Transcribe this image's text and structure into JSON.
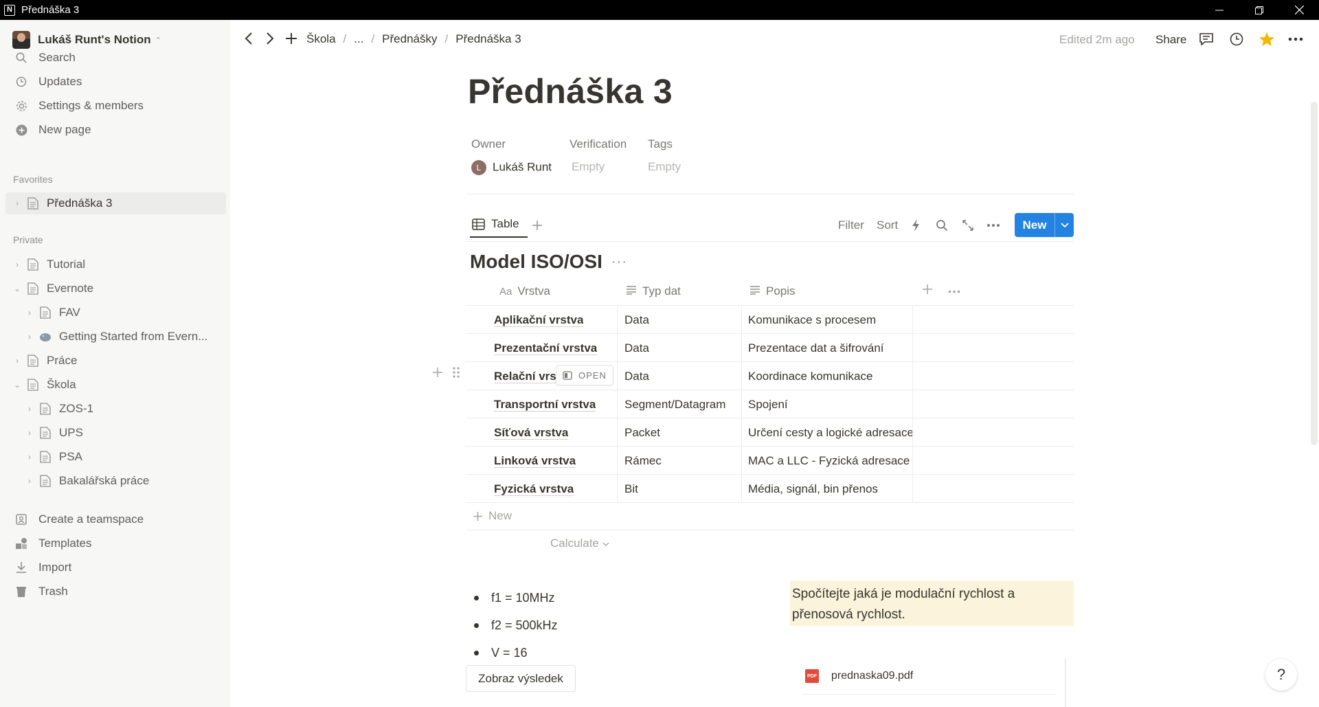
{
  "window": {
    "title": "Přednáška 3"
  },
  "workspace": {
    "name": "Lukáš Runt's Notion"
  },
  "sidebar": {
    "top": [
      {
        "label": "Search",
        "icon": "search-icon"
      },
      {
        "label": "Updates",
        "icon": "clock-icon"
      },
      {
        "label": "Settings & members",
        "icon": "gear-icon"
      },
      {
        "label": "New page",
        "icon": "plus-circle-icon"
      }
    ],
    "favorites_label": "Favorites",
    "favorites": [
      {
        "label": "Přednáška 3"
      }
    ],
    "private_label": "Private",
    "private": [
      {
        "label": "Tutorial"
      },
      {
        "label": "Evernote"
      },
      {
        "label": "FAV"
      },
      {
        "label": "Getting Started from Evern..."
      },
      {
        "label": "Práce"
      },
      {
        "label": "Škola"
      },
      {
        "label": "ZOS-1"
      },
      {
        "label": "UPS"
      },
      {
        "label": "PSA"
      },
      {
        "label": "Bakalářská práce"
      }
    ],
    "bottom": [
      {
        "label": "Create a teamspace",
        "icon": "teamspace-icon"
      },
      {
        "label": "Templates",
        "icon": "templates-icon"
      },
      {
        "label": "Import",
        "icon": "download-icon"
      },
      {
        "label": "Trash",
        "icon": "trash-icon"
      }
    ]
  },
  "topbar": {
    "breadcrumbs": [
      "Škola",
      "...",
      "Přednášky",
      "Přednáška 3"
    ],
    "edited": "Edited 2m ago",
    "share": "Share"
  },
  "page": {
    "title": "Přednáška 3",
    "props": {
      "owner_label": "Owner",
      "owner_initial": "L",
      "owner_value": "Lukáš Runt",
      "verification_label": "Verification",
      "verification_value": "Empty",
      "tags_label": "Tags",
      "tags_value": "Empty"
    }
  },
  "database": {
    "view_tab": "Table",
    "toolbar": {
      "filter": "Filter",
      "sort": "Sort",
      "new": "New"
    },
    "title": "Model ISO/OSI",
    "columns": [
      {
        "prefix": "Aa",
        "label": "Vrstva"
      },
      {
        "prefix": "",
        "label": "Typ dat"
      },
      {
        "prefix": "",
        "label": "Popis"
      }
    ],
    "rows": [
      {
        "vrstva": "Aplikační vrstva",
        "typ": "Data",
        "popis": "Komunikace s procesem"
      },
      {
        "vrstva": "Prezentační vrstva",
        "typ": "Data",
        "popis": "Prezentace dat a šifrování"
      },
      {
        "vrstva": "Relační vrst",
        "typ": "Data",
        "popis": "Koordinace komunikace"
      },
      {
        "vrstva": "Transportní vrstva",
        "typ": "Segment/Datagram",
        "popis": "Spojení"
      },
      {
        "vrstva": "Síťová vrstva",
        "typ": "Packet",
        "popis": "Určení cesty a logické adresace"
      },
      {
        "vrstva": "Linková vrstva",
        "typ": "Rámec",
        "popis": "MAC a LLC - Fyzická adresace"
      },
      {
        "vrstva": "Fyzická vrstva",
        "typ": "Bit",
        "popis": "Média, signál, bin přenos"
      }
    ],
    "open_tag": "OPEN",
    "new_row": "New",
    "calculate": "Calculate"
  },
  "bullets": [
    "f1 = 10MHz",
    "f2 = 500kHz",
    "V = 16"
  ],
  "show_button": "Zobraz výsledek",
  "callout": "Spočítejte jaká je modulační rychlost a přenosová rychlost.",
  "pdf": {
    "name": "prednaska09.pdf",
    "badge": "PDF"
  },
  "help": "?",
  "colors": {
    "accent": "#2383e2",
    "callout_bg": "#fbf3db",
    "sidebar_bg": "#f7f7f5",
    "star": "#f5b800"
  }
}
